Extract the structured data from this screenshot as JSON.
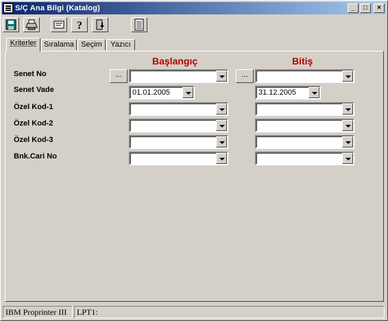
{
  "window": {
    "title": "S/Ç Ana Bilgi (Katalog)",
    "controls": {
      "minimize": "_",
      "maximize": "□",
      "close": "×"
    }
  },
  "toolbar": {
    "buttons": [
      {
        "icon": "save-disk-icon"
      },
      {
        "icon": "printer-icon"
      },
      {
        "icon": "preview-icon"
      },
      {
        "icon": "help-question-icon"
      },
      {
        "icon": "exit-door-icon"
      },
      {
        "icon": "document-list-icon"
      }
    ]
  },
  "tabs": [
    {
      "label": "Kriterler",
      "active": true
    },
    {
      "label": "Sıralama",
      "active": false
    },
    {
      "label": "Seçim",
      "active": false
    },
    {
      "label": "Yazıcı",
      "active": false
    }
  ],
  "columns": {
    "start": "Başlangıç",
    "end": "Bitiş"
  },
  "ellipsis_label": "...",
  "rows": [
    {
      "label": "Senet No",
      "start": "",
      "end": ""
    },
    {
      "label": "Senet Vade",
      "start": "01.01.2005",
      "end": "31.12.2005"
    },
    {
      "label": "Özel Kod-1",
      "start": "",
      "end": ""
    },
    {
      "label": "Özel Kod-2",
      "start": "",
      "end": ""
    },
    {
      "label": "Özel Kod-3",
      "start": "",
      "end": ""
    },
    {
      "label": "Bnk.Cari No",
      "start": "",
      "end": ""
    }
  ],
  "status": {
    "printer": "IBM Proprinter III",
    "port": "LPT1:"
  },
  "colors": {
    "column_header": "#b50000",
    "title_bar_start": "#0a246a",
    "title_bar_end": "#a6caf0"
  }
}
